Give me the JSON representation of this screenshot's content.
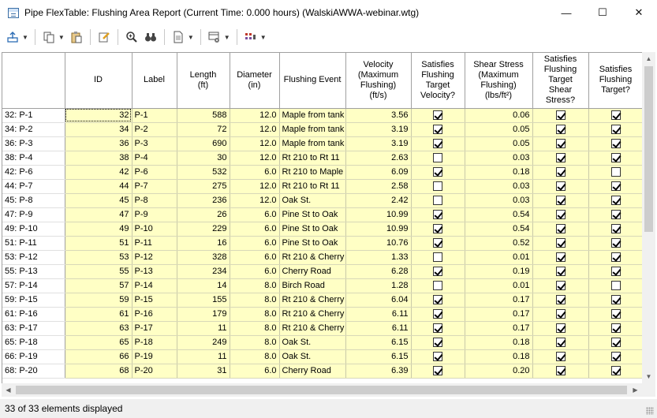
{
  "window": {
    "title": "Pipe FlexTable: Flushing Area Report (Current Time:  0.000 hours) (WalskiAWWA-webinar.wtg)",
    "minimize": "—",
    "maximize": "☐",
    "close": "✕"
  },
  "toolbar": {
    "items": [
      {
        "icon": "export-icon",
        "dropdown": true
      },
      {
        "icon": "copy-icon",
        "dropdown": true
      },
      {
        "icon": "clipboard-icon",
        "dropdown": false
      },
      {
        "icon": "edit-icon",
        "dropdown": false
      },
      {
        "icon": "zoom-icon",
        "dropdown": false
      },
      {
        "icon": "find-icon",
        "dropdown": false
      },
      {
        "icon": "report-icon",
        "dropdown": true
      },
      {
        "icon": "options-icon",
        "dropdown": true
      },
      {
        "icon": "highlight-icon",
        "dropdown": true
      }
    ]
  },
  "table": {
    "columns": [
      "",
      "ID",
      "Label",
      "Length\n(ft)",
      "Diameter\n(in)",
      "Flushing Event",
      "Velocity\n(Maximum\nFlushing)\n(ft/s)",
      "Satisfies\nFlushing\nTarget\nVelocity?",
      "Shear Stress\n(Maximum\nFlushing)\n(lbs/ft²)",
      "Satisfies\nFlushing\nTarget\nShear\nStress?",
      "Satisfies\nFlushing\nTarget?"
    ],
    "rows": [
      [
        "32: P-1",
        "32",
        "P-1",
        "588",
        "12.0",
        "Maple from tank",
        "3.56",
        true,
        "0.06",
        true,
        true
      ],
      [
        "34: P-2",
        "34",
        "P-2",
        "72",
        "12.0",
        "Maple from tank",
        "3.19",
        true,
        "0.05",
        true,
        true
      ],
      [
        "36: P-3",
        "36",
        "P-3",
        "690",
        "12.0",
        "Maple from tank",
        "3.19",
        true,
        "0.05",
        true,
        true
      ],
      [
        "38: P-4",
        "38",
        "P-4",
        "30",
        "12.0",
        "Rt 210 to Rt 11",
        "2.63",
        false,
        "0.03",
        true,
        true
      ],
      [
        "42: P-6",
        "42",
        "P-6",
        "532",
        "6.0",
        "Rt 210 to Maple",
        "6.09",
        true,
        "0.18",
        true,
        false
      ],
      [
        "44: P-7",
        "44",
        "P-7",
        "275",
        "12.0",
        "Rt 210 to Rt 11",
        "2.58",
        false,
        "0.03",
        true,
        true
      ],
      [
        "45: P-8",
        "45",
        "P-8",
        "236",
        "12.0",
        "Oak St.",
        "2.42",
        false,
        "0.03",
        true,
        true
      ],
      [
        "47: P-9",
        "47",
        "P-9",
        "26",
        "6.0",
        "Pine St to Oak",
        "10.99",
        true,
        "0.54",
        true,
        true
      ],
      [
        "49: P-10",
        "49",
        "P-10",
        "229",
        "6.0",
        "Pine St to Oak",
        "10.99",
        true,
        "0.54",
        true,
        true
      ],
      [
        "51: P-11",
        "51",
        "P-11",
        "16",
        "6.0",
        "Pine St to Oak",
        "10.76",
        true,
        "0.52",
        true,
        true
      ],
      [
        "53: P-12",
        "53",
        "P-12",
        "328",
        "6.0",
        "Rt 210 & Cherry",
        "1.33",
        false,
        "0.01",
        true,
        true
      ],
      [
        "55: P-13",
        "55",
        "P-13",
        "234",
        "6.0",
        "Cherry Road",
        "6.28",
        true,
        "0.19",
        true,
        true
      ],
      [
        "57: P-14",
        "57",
        "P-14",
        "14",
        "8.0",
        "Birch Road",
        "1.28",
        false,
        "0.01",
        true,
        false
      ],
      [
        "59: P-15",
        "59",
        "P-15",
        "155",
        "8.0",
        "Rt 210 & Cherry",
        "6.04",
        true,
        "0.17",
        true,
        true
      ],
      [
        "61: P-16",
        "61",
        "P-16",
        "179",
        "8.0",
        "Rt 210 & Cherry",
        "6.11",
        true,
        "0.17",
        true,
        true
      ],
      [
        "63: P-17",
        "63",
        "P-17",
        "11",
        "8.0",
        "Rt 210 & Cherry",
        "6.11",
        true,
        "0.17",
        true,
        true
      ],
      [
        "65: P-18",
        "65",
        "P-18",
        "249",
        "8.0",
        "Oak St.",
        "6.15",
        true,
        "0.18",
        true,
        true
      ],
      [
        "66: P-19",
        "66",
        "P-19",
        "11",
        "8.0",
        "Oak St.",
        "6.15",
        true,
        "0.18",
        true,
        true
      ],
      [
        "68: P-20",
        "68",
        "P-20",
        "31",
        "6.0",
        "Cherry Road",
        "6.39",
        true,
        "0.20",
        true,
        true
      ]
    ]
  },
  "status": {
    "text": "33 of 33 elements displayed"
  },
  "colors": {
    "cell_background": "#ffffc5",
    "grid_line": "#a0a0a0"
  }
}
